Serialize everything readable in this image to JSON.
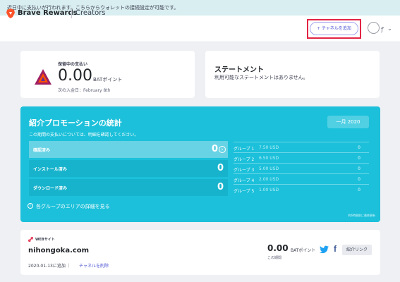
{
  "notice": {
    "text": "近日中に支払いが行われます。こちらからウォレットの接続設定が可能です。"
  },
  "header": {
    "brand": "Brave Rewards",
    "section": "Creators",
    "add_channel_label": "+ チャネルを追加"
  },
  "payout": {
    "label": "保留中の支払い",
    "amount": "0.00",
    "unit": "BATポイント",
    "next_deposit": "次の入金日：February 8th"
  },
  "statement": {
    "title": "ステートメント",
    "text": "利用可能なステートメントはありません。"
  },
  "promo": {
    "title": "紹介プロモーションの統計",
    "subtitle": "この期間の支払いについては、明細を確認してください。",
    "month": "一月 2020",
    "stats": [
      {
        "label": "確認済み",
        "value": "0"
      },
      {
        "label": "インストール済み",
        "value": "0"
      },
      {
        "label": "ダウンロード済み",
        "value": "0"
      }
    ],
    "groups": [
      {
        "name": "グループ 1",
        "rate": "7.50 USD",
        "count": "0"
      },
      {
        "name": "グループ 2",
        "rate": "6.50 USD",
        "count": "0"
      },
      {
        "name": "グループ 3",
        "rate": "5.00 USD",
        "count": "0"
      },
      {
        "name": "グループ 4",
        "rate": "2.00 USD",
        "count": "0"
      },
      {
        "name": "グループ 5",
        "rate": "1.00 USD",
        "count": "0"
      }
    ],
    "info_text": "各グループのエリアの詳細を見る",
    "updated": "約6時間前に最終更新"
  },
  "site": {
    "type": "WEBサイト",
    "name": "nihongoka.com",
    "added": "2020-01-13に追加 ｜",
    "remove": "チャネルを削除",
    "amount": "0.00",
    "unit": "BATポイント",
    "period": "この期間",
    "referral_label": "紹介リンク",
    "facebook_glyph": "f"
  },
  "colors": {
    "accent": "#4c54d2",
    "promo_bg": "#1cc0da",
    "highlight_outline": "#e32444",
    "brave_orange": "#fb542b"
  }
}
